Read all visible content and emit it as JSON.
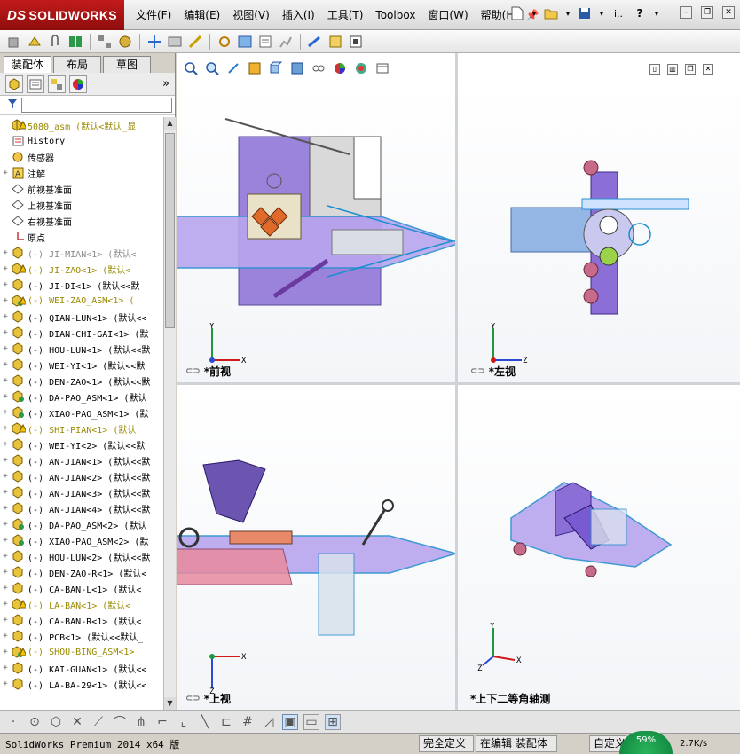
{
  "app": {
    "brand": "SOLIDWORKS",
    "brand_prefix": "DS"
  },
  "menu": [
    "文件(F)",
    "编辑(E)",
    "视图(V)",
    "插入(I)",
    "工具(T)",
    "Toolbox",
    "窗口(W)",
    "帮助(H)"
  ],
  "title_tools": {
    "doc_name": "i.."
  },
  "tabs": [
    "装配体",
    "布局",
    "草图"
  ],
  "tree": [
    {
      "label": "5080_asm  (默认<默认_显",
      "icon": "assembly-icon",
      "state": "warn",
      "expand": ""
    },
    {
      "label": "History",
      "icon": "history-icon",
      "state": "normal",
      "expand": ""
    },
    {
      "label": "传感器",
      "icon": "sensor-icon",
      "state": "normal",
      "expand": ""
    },
    {
      "label": "注解",
      "icon": "annotation-icon",
      "state": "normal",
      "expand": "+"
    },
    {
      "label": "前视基准面",
      "icon": "plane-icon",
      "state": "normal",
      "expand": ""
    },
    {
      "label": "上视基准面",
      "icon": "plane-icon",
      "state": "normal",
      "expand": ""
    },
    {
      "label": "右视基准面",
      "icon": "plane-icon",
      "state": "normal",
      "expand": ""
    },
    {
      "label": "原点",
      "icon": "origin-icon",
      "state": "normal",
      "expand": ""
    },
    {
      "label": "(-) JI-MIAN<1> (默认<",
      "icon": "part-icon",
      "state": "supp",
      "expand": "+"
    },
    {
      "label": "(-) JI-ZAO<1> (默认<",
      "icon": "part-icon",
      "state": "warn",
      "expand": "+"
    },
    {
      "label": "(-) JI-DI<1> (默认<<默",
      "icon": "part-icon",
      "state": "normal",
      "expand": "+"
    },
    {
      "label": "(-) WEI-ZAO_ASM<1> (",
      "icon": "subassembly-icon",
      "state": "warn",
      "expand": "+"
    },
    {
      "label": "(-) QIAN-LUN<1> (默认<<",
      "icon": "part-icon",
      "state": "normal",
      "expand": "+"
    },
    {
      "label": "(-) DIAN-CHI-GAI<1> (默",
      "icon": "part-icon",
      "state": "normal",
      "expand": "+"
    },
    {
      "label": "(-) HOU-LUN<1> (默认<<默",
      "icon": "part-icon",
      "state": "normal",
      "expand": "+"
    },
    {
      "label": "(-) WEI-YI<1> (默认<<默",
      "icon": "part-icon",
      "state": "normal",
      "expand": "+"
    },
    {
      "label": "(-) DEN-ZAO<1> (默认<<默",
      "icon": "part-icon",
      "state": "normal",
      "expand": "+"
    },
    {
      "label": "(-) DA-PAO_ASM<1> (默认",
      "icon": "subassembly-icon",
      "state": "normal",
      "expand": "+"
    },
    {
      "label": "(-) XIAO-PAO_ASM<1> (默",
      "icon": "subassembly-icon",
      "state": "normal",
      "expand": "+"
    },
    {
      "label": "(-) SHI-PIAN<1> (默认",
      "icon": "part-icon",
      "state": "warn",
      "expand": "+"
    },
    {
      "label": "(-) WEI-YI<2> (默认<<默",
      "icon": "part-icon",
      "state": "normal",
      "expand": "+"
    },
    {
      "label": "(-) AN-JIAN<1> (默认<<默",
      "icon": "part-icon",
      "state": "normal",
      "expand": "+"
    },
    {
      "label": "(-) AN-JIAN<2> (默认<<默",
      "icon": "part-icon",
      "state": "normal",
      "expand": "+"
    },
    {
      "label": "(-) AN-JIAN<3> (默认<<默",
      "icon": "part-icon",
      "state": "normal",
      "expand": "+"
    },
    {
      "label": "(-) AN-JIAN<4> (默认<<默",
      "icon": "part-icon",
      "state": "normal",
      "expand": "+"
    },
    {
      "label": "(-) DA-PAO_ASM<2> (默认",
      "icon": "subassembly-icon",
      "state": "normal",
      "expand": "+"
    },
    {
      "label": "(-) XIAO-PAO_ASM<2> (默",
      "icon": "subassembly-icon",
      "state": "normal",
      "expand": "+"
    },
    {
      "label": "(-) HOU-LUN<2> (默认<<默",
      "icon": "part-icon",
      "state": "normal",
      "expand": "+"
    },
    {
      "label": "(-) DEN-ZAO-R<1> (默认<",
      "icon": "part-icon",
      "state": "normal",
      "expand": "+"
    },
    {
      "label": "(-) CA-BAN-L<1> (默认<",
      "icon": "part-icon",
      "state": "normal",
      "expand": "+"
    },
    {
      "label": "(-) LA-BAN<1> (默认<",
      "icon": "part-icon",
      "state": "warn",
      "expand": "+"
    },
    {
      "label": "(-) CA-BAN-R<1> (默认<",
      "icon": "part-icon",
      "state": "normal",
      "expand": "+"
    },
    {
      "label": "(-) PCB<1> (默认<<默认_",
      "icon": "part-icon",
      "state": "normal",
      "expand": "+"
    },
    {
      "label": "(-) SHOU-BING_ASM<1>",
      "icon": "subassembly-icon",
      "state": "warn",
      "expand": "+"
    },
    {
      "label": "(-) KAI-GUAN<1> (默认<<",
      "icon": "part-icon",
      "state": "normal",
      "expand": "+"
    },
    {
      "label": "(-) LA-BA-29<1> (默认<<",
      "icon": "part-icon",
      "state": "normal",
      "expand": "+"
    }
  ],
  "viewports": {
    "front": "*前视",
    "left": "*左视",
    "top": "*上视",
    "iso": "*上下二等角轴测"
  },
  "axes": {
    "x": "X",
    "y": "Y",
    "z": "Z"
  },
  "status": {
    "app_info": "SolidWorks Premium 2014 x64 版",
    "fully_defined": "完全定义",
    "editing": "在编辑 装配体",
    "custom": "自定义",
    "speed": "2.7K/s",
    "badge": "59%"
  },
  "colors": {
    "brand_red": "#b01616",
    "part_purple": "#8b5cf6",
    "part_pink": "#e88aa0",
    "edge_blue": "#1a8fd0"
  }
}
